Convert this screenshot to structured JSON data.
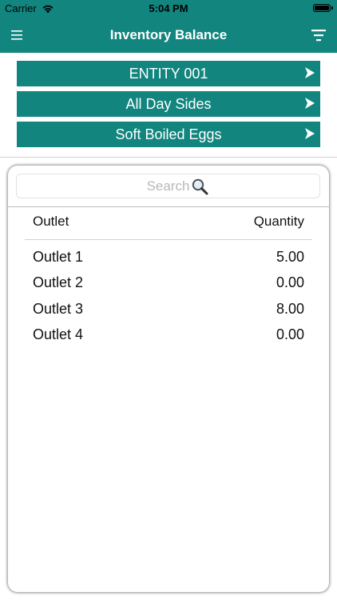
{
  "status_bar": {
    "carrier": "Carrier",
    "time": "5:04 PM"
  },
  "nav": {
    "title": "Inventory Balance",
    "menu_icon": "hamburger-menu-icon",
    "filter_icon": "filter-icon"
  },
  "selectors": [
    {
      "label": "ENTITY 001"
    },
    {
      "label": "All Day Sides"
    },
    {
      "label": "Soft Boiled Eggs"
    }
  ],
  "search": {
    "placeholder": "Search",
    "value": ""
  },
  "table": {
    "columns": [
      "Outlet",
      "Quantity"
    ],
    "rows": [
      {
        "outlet": "Outlet 1",
        "quantity": "5.00"
      },
      {
        "outlet": "Outlet 2",
        "quantity": "0.00"
      },
      {
        "outlet": "Outlet 3",
        "quantity": "8.00"
      },
      {
        "outlet": "Outlet 4",
        "quantity": "0.00"
      }
    ]
  },
  "colors": {
    "accent": "#12857f",
    "text": "#111111",
    "placeholder": "#b8b8b8"
  }
}
